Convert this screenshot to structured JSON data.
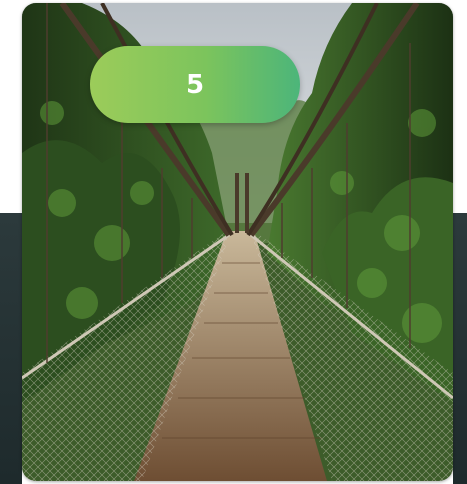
{
  "badge": {
    "number": "5"
  },
  "image": {
    "subject": "jungle-suspension-bridge-photo"
  },
  "colors": {
    "badge_start": "#9ccc5a",
    "badge_end": "#4cb57a",
    "badge_text": "#ffffff",
    "sky": "#c9ced2",
    "foliage": "#2f4a22",
    "deck": "#8a6a4a"
  }
}
